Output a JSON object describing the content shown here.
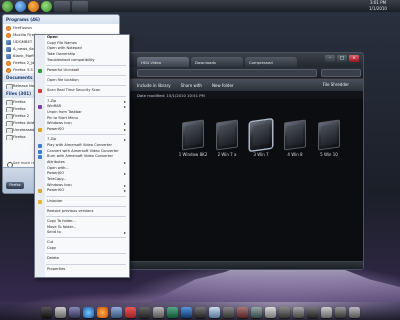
{
  "clock": {
    "time": "3:01 PM",
    "date": "1/1/2010"
  },
  "start_menu": {
    "programs_title": "Programs (46)",
    "programs": [
      "FireFusion",
      "Mozilla Firefox",
      "UDGMBET",
      "A_news_6x5",
      "Blank_Moffat",
      "Firefox 2_jan 03",
      "Firefox 3.5 Build"
    ],
    "documents_title": "Documents",
    "documents": [
      "Release Notes"
    ],
    "files_title": "Files (301)",
    "files": [
      "Firefox",
      "Firefox",
      "Firefox 2",
      "Firefox Addon",
      "Unreleased Firefox",
      "Firefox"
    ],
    "search_more": "See more results",
    "shutdown_label": "Firefox"
  },
  "explorer": {
    "tabs": [
      "HD4 Video",
      "Downloads",
      "Compressed"
    ],
    "toolbar": [
      "Include in library",
      "Share with",
      "New folder"
    ],
    "toolbar_right": "File Shredder",
    "info": "Date modified: 15/1/2010 10:51 PM",
    "folders": [
      {
        "label": "1 Window 8K2",
        "selected": false
      },
      {
        "label": "2 Win 7 a",
        "selected": false
      },
      {
        "label": "3 Win 7",
        "selected": true
      },
      {
        "label": "4 Win 8",
        "selected": false
      },
      {
        "label": "5 Win 10",
        "selected": false
      }
    ]
  },
  "context_menu": {
    "items": [
      {
        "label": "Open",
        "bold": true,
        "icon": "",
        "submenu": false
      },
      {
        "label": "Copy File Names",
        "icon": "",
        "submenu": false
      },
      {
        "label": "Open with Notepad",
        "icon": "",
        "submenu": false
      },
      {
        "label": "Take Ownership",
        "icon": "",
        "submenu": false
      },
      {
        "label": "Troubleshoot compatibility",
        "icon": "",
        "submenu": false
      },
      {
        "sep": true
      },
      {
        "label": "Powerful Uninstall",
        "icon": "#2f9a3a",
        "submenu": false
      },
      {
        "sep": true
      },
      {
        "label": "Open file location",
        "icon": "",
        "submenu": false
      },
      {
        "sep": true
      },
      {
        "label": "Scan Real Time Security Scan",
        "icon": "#d23c3c",
        "submenu": false
      },
      {
        "sep": true
      },
      {
        "label": "7-Zip",
        "icon": "",
        "submenu": true
      },
      {
        "label": "WinRAR",
        "icon": "#7a3fa0",
        "submenu": true
      },
      {
        "label": "Unpin from Taskbar",
        "icon": "",
        "submenu": false
      },
      {
        "label": "Pin to Start Menu",
        "icon": "",
        "submenu": false
      },
      {
        "label": "Windows Icon",
        "icon": "",
        "submenu": true
      },
      {
        "label": "PowerISO",
        "icon": "#d9a531",
        "submenu": true
      },
      {
        "sep": true
      },
      {
        "label": "7-Zip",
        "icon": "",
        "submenu": true
      },
      {
        "label": "Play with Aimersoft Video Converter",
        "icon": "#3a7bd5",
        "submenu": false
      },
      {
        "label": "Convert with Aimersoft Video Converter",
        "icon": "#3a7bd5",
        "submenu": false
      },
      {
        "label": "Burn with Aimersoft Video Converter",
        "icon": "#3a7bd5",
        "submenu": false
      },
      {
        "label": "Attributes",
        "icon": "",
        "submenu": true
      },
      {
        "label": "Open with...",
        "icon": "",
        "submenu": false
      },
      {
        "label": "PowerISO",
        "icon": "",
        "submenu": true
      },
      {
        "label": "TeraCopy...",
        "icon": "",
        "submenu": false
      },
      {
        "label": "Windows Icon",
        "icon": "",
        "submenu": true
      },
      {
        "label": "PowerISO",
        "icon": "#d9a531",
        "submenu": true
      },
      {
        "sep": true
      },
      {
        "label": "Unlocker",
        "icon": "#e2b633",
        "submenu": false
      },
      {
        "sep": true
      },
      {
        "label": "Restore previous versions",
        "icon": "",
        "submenu": false
      },
      {
        "sep": true
      },
      {
        "label": "Copy To folder...",
        "icon": "",
        "submenu": false
      },
      {
        "label": "Move To folder...",
        "icon": "",
        "submenu": false
      },
      {
        "label": "Send to",
        "icon": "",
        "submenu": true
      },
      {
        "sep": true
      },
      {
        "label": "Cut",
        "icon": "",
        "submenu": false
      },
      {
        "label": "Copy",
        "icon": "",
        "submenu": false
      },
      {
        "sep": true
      },
      {
        "label": "Delete",
        "icon": "",
        "submenu": false
      },
      {
        "sep": true
      },
      {
        "label": "Properties",
        "icon": "",
        "submenu": false
      }
    ]
  }
}
